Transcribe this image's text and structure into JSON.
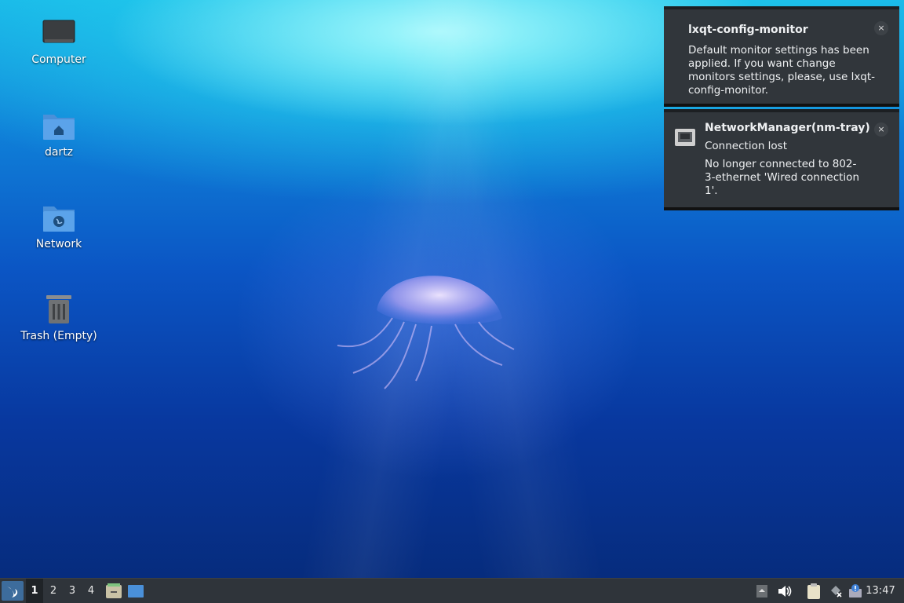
{
  "desktop": {
    "icons": [
      {
        "label": "Computer",
        "icon": "monitor-icon"
      },
      {
        "label": "dartz",
        "icon": "home-folder-icon"
      },
      {
        "label": "Network",
        "icon": "network-folder-icon"
      },
      {
        "label": "Trash (Empty)",
        "icon": "trash-icon"
      }
    ]
  },
  "notifications": [
    {
      "title": "lxqt-config-monitor",
      "body": "Default monitor settings has been applied. If you want change monitors settings, please, use lxqt-config-monitor.",
      "close": "×"
    },
    {
      "title": "NetworkManager(nm-tray)",
      "subtitle": "Connection lost",
      "body": "No longer connected to 802-3-ethernet 'Wired connection 1'.",
      "icon": "network-wired-icon",
      "close": "×"
    }
  ],
  "taskbar": {
    "workspaces": [
      "1",
      "2",
      "3",
      "4"
    ],
    "active_workspace": "1",
    "clock": "13:47",
    "tray_icons": [
      "tray-up-icon",
      "volume-icon",
      "clipboard-icon",
      "network-disconnected-icon",
      "notification-icon"
    ]
  },
  "colors": {
    "notification_bg": "#31363b",
    "taskbar_bg": "#2f343a",
    "start_button": "#3d6c9c"
  }
}
